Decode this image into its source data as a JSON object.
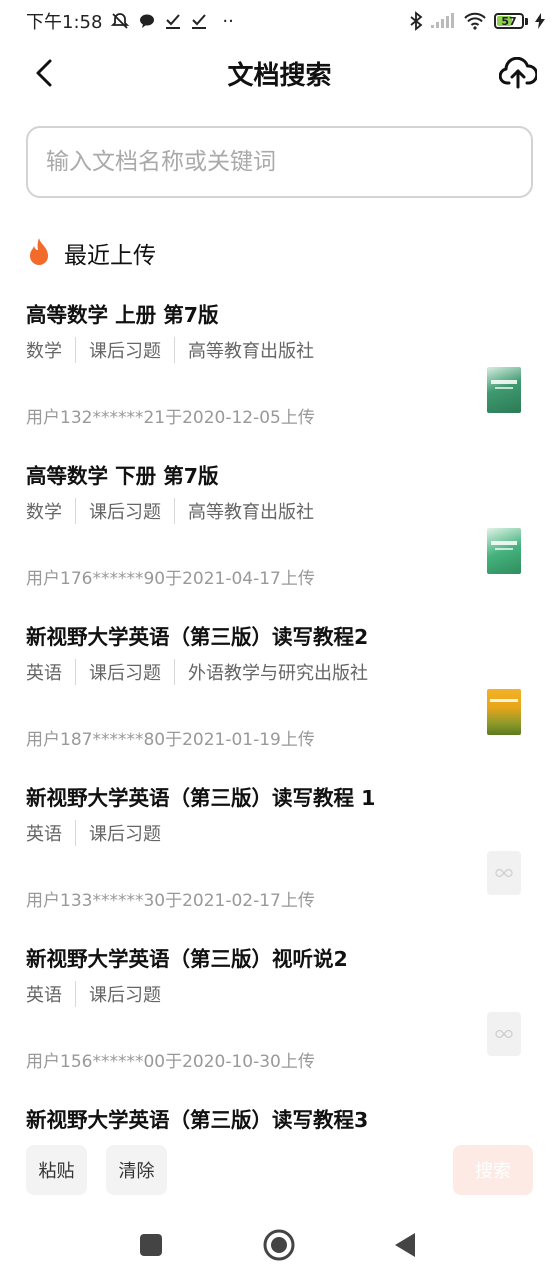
{
  "status_bar": {
    "time": "下午1:58",
    "notification_icons": [
      "mute-icon",
      "chat-icon",
      "check-icon",
      "check-icon",
      "more-dots-icon"
    ],
    "battery_level": "57",
    "more_indicator": "··"
  },
  "header": {
    "title": "文档搜索",
    "back_icon": "chevron-left-icon",
    "upload_icon": "cloud-upload-icon"
  },
  "search": {
    "placeholder": "输入文档名称或关键词",
    "value": ""
  },
  "section": {
    "icon": "flame-icon",
    "title": "最近上传"
  },
  "documents": [
    {
      "title": "高等数学 上册 第7版",
      "tags": [
        "数学",
        "课后习题",
        "高等教育出版社"
      ],
      "meta": "用户132******21于2020-12-05上传",
      "thumbnail": "green-book-cover"
    },
    {
      "title": "高等数学 下册 第7版",
      "tags": [
        "数学",
        "课后习题",
        "高等教育出版社"
      ],
      "meta": "用户176******90于2021-04-17上传",
      "thumbnail": "green-book-cover"
    },
    {
      "title": "新视野大学英语（第三版）读写教程2",
      "tags": [
        "英语",
        "课后习题",
        "外语教学与研究出版社"
      ],
      "meta": "用户187******80于2021-01-19上传",
      "thumbnail": "yellow-book-cover"
    },
    {
      "title": "新视野大学英语（第三版）读写教程 1",
      "tags": [
        "英语",
        "课后习题"
      ],
      "meta": "用户133******30于2021-02-17上传",
      "thumbnail": "placeholder-image"
    },
    {
      "title": "新视野大学英语（第三版）视听说2",
      "tags": [
        "英语",
        "课后习题"
      ],
      "meta": "用户156******00于2020-10-30上传",
      "thumbnail": "placeholder-image"
    },
    {
      "title": "新视野大学英语（第三版）读写教程3",
      "tags": [],
      "meta": "",
      "thumbnail": ""
    }
  ],
  "actions": {
    "paste_label": "粘贴",
    "clear_label": "清除",
    "search_label": "搜索"
  },
  "colors": {
    "accent": "#f26b2a",
    "search_button_bg": "#fdeae4",
    "tag_text": "#666666",
    "meta_text": "#999999"
  }
}
